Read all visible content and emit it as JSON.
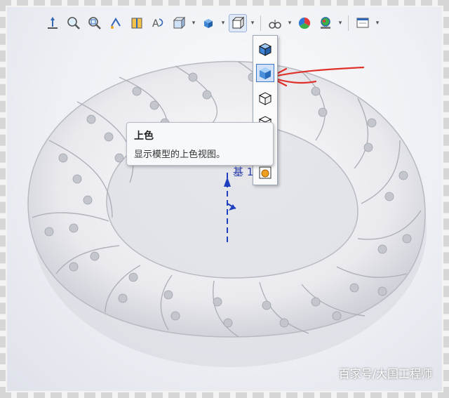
{
  "toolbar": {
    "icons": [
      "view-orientation-icon",
      "zoom-to-fit-icon",
      "zoom-to-area-icon",
      "previous-view-icon",
      "section-view-icon",
      "dynamic-annotation-icon",
      "view-orientation-dropdown-icon",
      "display-style-icon",
      "hide-show-items-icon",
      "edit-appearance-icon",
      "apply-scene-icon",
      "view-settings-icon"
    ]
  },
  "flyout": {
    "items": [
      "shaded-with-edges-icon",
      "shaded-icon",
      "hidden-lines-removed-icon",
      "hidden-lines-visible-icon",
      "wireframe-icon"
    ],
    "selected": "shaded-icon"
  },
  "tooltip": {
    "title": "上色",
    "description": "显示模型的上色视图。"
  },
  "viewport": {
    "axis_label": "基 1"
  },
  "watermark": "百家号/大国工程师",
  "colors": {
    "accent_blue": "#2f78d4",
    "annotation_red": "#e0302a"
  }
}
